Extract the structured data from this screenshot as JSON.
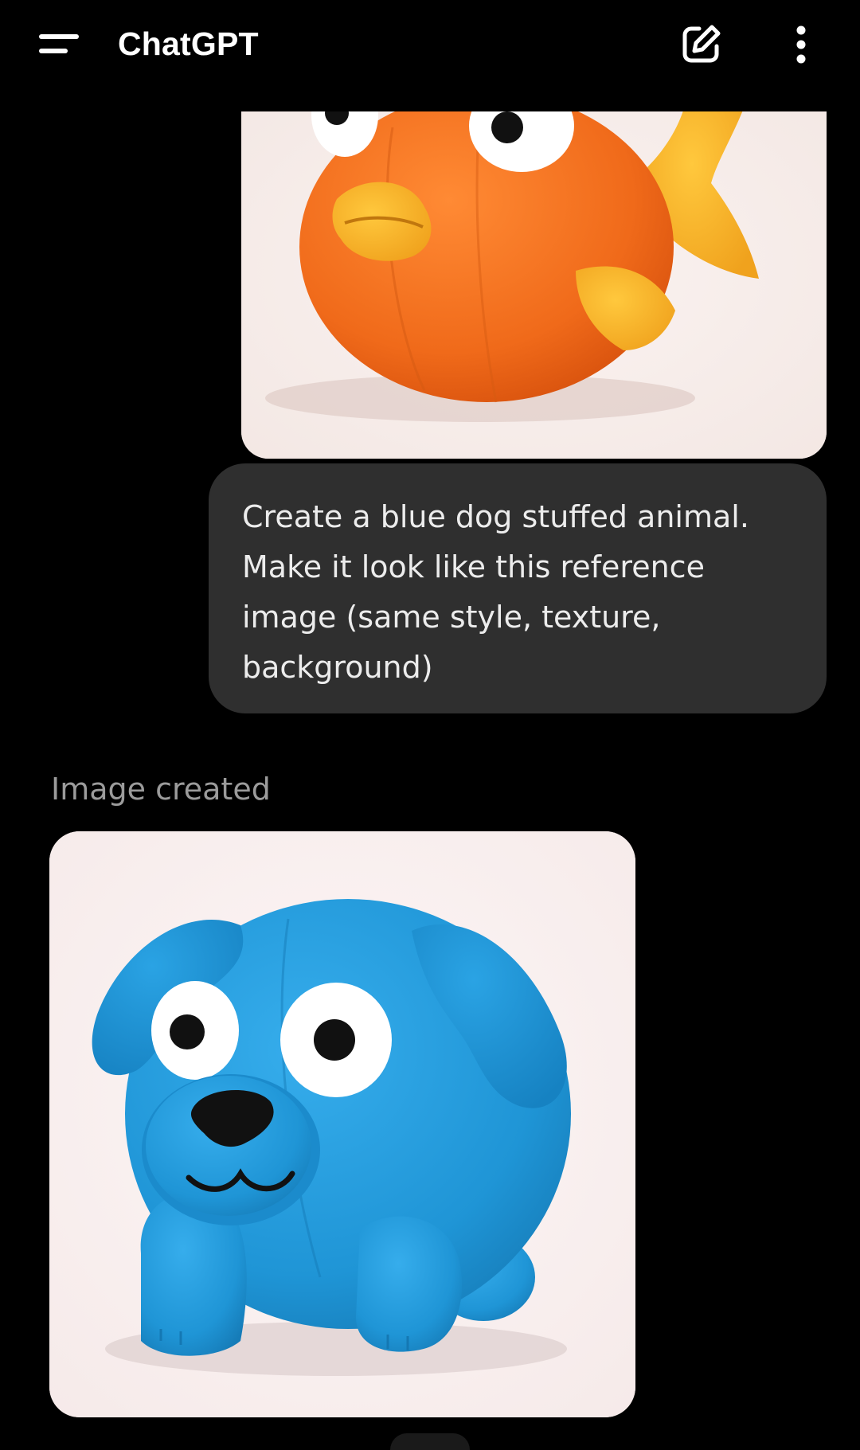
{
  "header": {
    "title": "ChatGPT",
    "menu_icon": "menu-icon",
    "new_chat_icon": "edit-icon",
    "more_icon": "more-vertical-icon"
  },
  "conversation": {
    "reference_image": {
      "kind": "image",
      "subject": "orange fish stuffed animal"
    },
    "user_message": "Create a blue dog stuffed animal. Make it look like this reference image (same style, texture, background)",
    "assistant_status": "Image created",
    "generated_image": {
      "kind": "image",
      "subject": "blue dog stuffed animal"
    }
  },
  "colors": {
    "background": "#000000",
    "user_bubble": "#2f2f2f",
    "status_text": "#9b9b9b",
    "fish_body": "#f36b1c",
    "fish_fins": "#f7b22a",
    "dog_body": "#1f95d6"
  }
}
